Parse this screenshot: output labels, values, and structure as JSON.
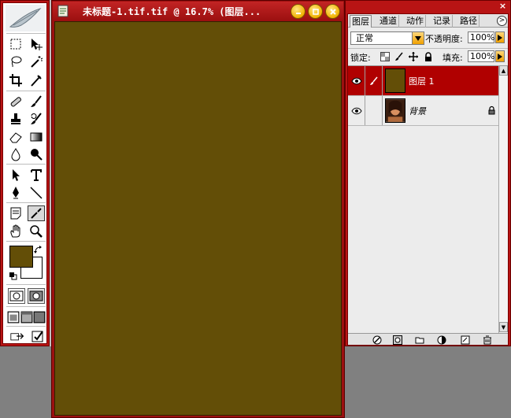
{
  "document": {
    "title": "未标题-1.tif.tif @ 16.7% (图层...",
    "canvas_color": "#634e07"
  },
  "colors": {
    "foreground": "#634e07",
    "background": "#ffffff",
    "chrome_red": "#b81414",
    "selected_layer": "#b00000"
  },
  "layers_panel": {
    "close_label": "×",
    "tabs": [
      {
        "label": "图层",
        "active": true
      },
      {
        "label": "通道",
        "active": false
      },
      {
        "label": "动作",
        "active": false
      },
      {
        "label": "记录",
        "active": false
      },
      {
        "label": "路径",
        "active": false
      }
    ],
    "menu_button": ">",
    "blend_mode": "正常",
    "opacity_label": "不透明度:",
    "opacity_value": "100%",
    "lock_label": "锁定:",
    "fill_label": "填充:",
    "fill_value": "100%",
    "layers": [
      {
        "name": "图层 1",
        "selected": true,
        "visible": true,
        "thumb": "solid-brown",
        "locked": false
      },
      {
        "name": "背景",
        "selected": false,
        "visible": true,
        "thumb": "portrait-photo",
        "locked": true
      }
    ],
    "footer_icons": [
      "layer-style-icon",
      "mask-icon",
      "new-group-icon",
      "adjustment-layer-icon",
      "new-layer-icon",
      "trash-icon"
    ]
  },
  "toolbox": {
    "tools": [
      "marquee-icon",
      "move-icon",
      "lasso-icon",
      "magic-wand-icon",
      "crop-icon",
      "slice-icon",
      "healing-brush-icon",
      "brush-icon",
      "clone-stamp-icon",
      "history-brush-icon",
      "eraser-icon",
      "gradient-icon",
      "blur-icon",
      "dodge-icon",
      "path-selection-icon",
      "type-icon",
      "pen-icon",
      "line-icon",
      "notes-icon",
      "eyedropper-icon",
      "hand-icon",
      "zoom-icon"
    ],
    "active_tool": "eyedropper-icon"
  }
}
